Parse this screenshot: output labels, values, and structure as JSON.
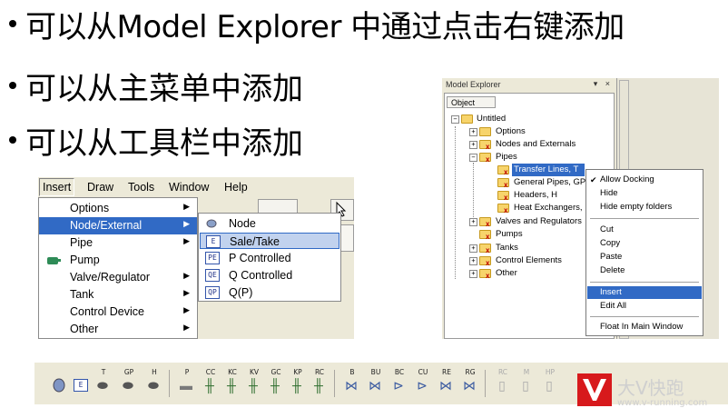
{
  "bullets": [
    "可以从Model Explorer 中通过点击右键添加",
    "可以从主菜单中添加",
    "可以从工具栏中添加"
  ],
  "menubar": [
    "Insert",
    "Draw",
    "Tools",
    "Window",
    "Help"
  ],
  "insert_menu": [
    "Options",
    "Node/External",
    "Pipe",
    "Pump",
    "Valve/Regulator",
    "Tank",
    "Control Device",
    "Other"
  ],
  "submenu": [
    {
      "icon": "E",
      "label": "Node"
    },
    {
      "icon": "E",
      "label": "Sale/Take"
    },
    {
      "icon": "PE",
      "label": "P Controlled"
    },
    {
      "icon": "QE",
      "label": "Q Controlled"
    },
    {
      "icon": "QP",
      "label": "Q(P)"
    }
  ],
  "explorer": {
    "title": "Model Explorer",
    "title_controls": "▾ ×",
    "tab": "Object",
    "tree": [
      "Untitled",
      "Options",
      "Nodes and Externals",
      "Pipes",
      "Transfer Lines, T",
      "General Pipes, GP",
      "Headers, H",
      "Heat Exchangers,",
      "Valves and Regulators",
      "Pumps",
      "Tanks",
      "Control Elements",
      "Other"
    ]
  },
  "context_menu": [
    "Allow Docking",
    "Hide",
    "Hide empty folders",
    "Cut",
    "Copy",
    "Paste",
    "Delete",
    "Insert",
    "Edit All",
    "Float In Main Window"
  ],
  "toolbar_captions": [
    "",
    "E",
    "T",
    "GP",
    "H",
    "P",
    "CC",
    "KC",
    "KV",
    "GC",
    "KP",
    "RC",
    "B",
    "BU",
    "BC",
    "CU",
    "RE",
    "RG",
    "RC",
    "M",
    "HP"
  ],
  "watermark": {
    "text": "大V快跑",
    "url": "www.v-running.com"
  },
  "colors": {
    "menu_highlight": "#316ac5",
    "submenu_highlight": "#c1d2ee",
    "chrome": "#ece9d8"
  }
}
